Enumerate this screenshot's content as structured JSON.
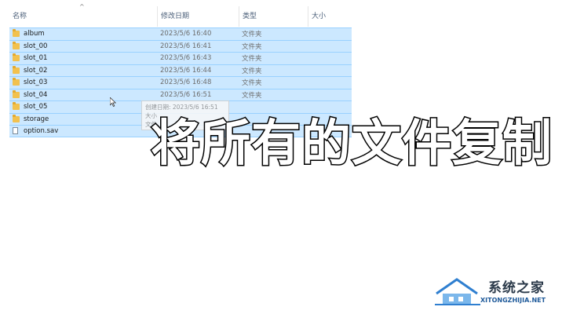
{
  "columns": {
    "name": "名称",
    "date": "修改日期",
    "type": "类型",
    "size": "大小"
  },
  "rows": [
    {
      "name": "album",
      "date": "2023/5/6 16:40",
      "type": "文件夹",
      "icon": "folder-icon"
    },
    {
      "name": "slot_00",
      "date": "2023/5/6 16:41",
      "type": "文件夹",
      "icon": "folder-icon"
    },
    {
      "name": "slot_01",
      "date": "2023/5/6 16:43",
      "type": "文件夹",
      "icon": "folder-icon"
    },
    {
      "name": "slot_02",
      "date": "2023/5/6 16:44",
      "type": "文件夹",
      "icon": "folder-icon"
    },
    {
      "name": "slot_03",
      "date": "2023/5/6 16:48",
      "type": "文件夹",
      "icon": "folder-icon"
    },
    {
      "name": "slot_04",
      "date": "2023/5/6 16:51",
      "type": "文件夹",
      "icon": "folder-icon"
    },
    {
      "name": "slot_05",
      "date": "",
      "type": "",
      "icon": "folder-icon"
    },
    {
      "name": "storage",
      "date": "",
      "type": "",
      "icon": "folder-icon"
    },
    {
      "name": "option.sav",
      "date": "",
      "type": "",
      "icon": "file-icon"
    }
  ],
  "tooltip": {
    "line1": "创建日期: 2023/5/6 16:51",
    "line2": "大小",
    "line3": "文件"
  },
  "caption": "将所有的文件复制",
  "watermark": {
    "title": "系统之家",
    "url": "XITONGZHIJIA.NET"
  },
  "colors": {
    "selection": "#cce8ff",
    "selection_border": "#99d1ff",
    "folder": "#f2c14e"
  }
}
